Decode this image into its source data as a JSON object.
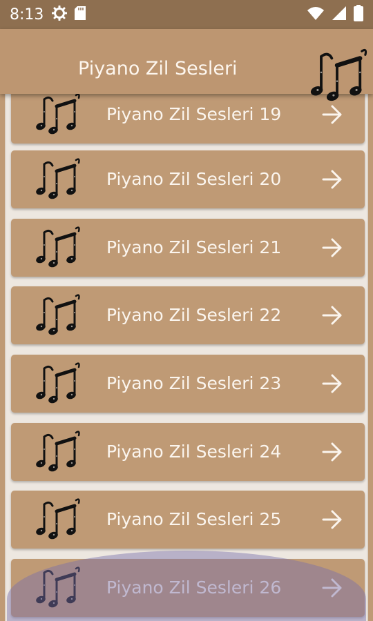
{
  "status": {
    "time": "8:13"
  },
  "icons": {
    "status_left": [
      "gear-icon",
      "sd-card-icon"
    ],
    "status_right": [
      "wifi-icon",
      "signal-icon",
      "battery-icon"
    ],
    "list": [
      "music-notes-icon",
      "arrow-right-icon"
    ]
  },
  "app": {
    "title": "Piyano Zil Sesleri"
  },
  "colors": {
    "status_bar": "#8e6f50",
    "app_bar": "#bd9671",
    "item_bg": "#bf9a75",
    "list_bg": "#ede7e0",
    "text": "#fbf5ee"
  },
  "list": {
    "items": [
      {
        "label": "Piyano Zil Sesleri 19"
      },
      {
        "label": "Piyano Zil Sesleri 20"
      },
      {
        "label": "Piyano Zil Sesleri 21"
      },
      {
        "label": "Piyano Zil Sesleri 22"
      },
      {
        "label": "Piyano Zil Sesleri 23"
      },
      {
        "label": "Piyano Zil Sesleri 24"
      },
      {
        "label": "Piyano Zil Sesleri 25"
      },
      {
        "label": "Piyano Zil Sesleri 26"
      }
    ]
  }
}
